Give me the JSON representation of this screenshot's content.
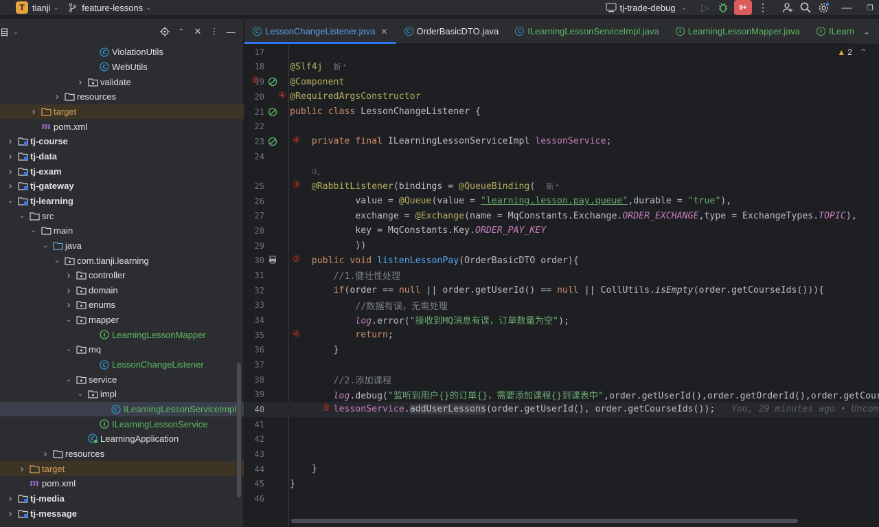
{
  "titlebar": {
    "project_badge": "T",
    "project_name": "tianji",
    "branch": "feature-lessons",
    "run_config": "tj-trade-debug",
    "notifications": "9+"
  },
  "project_panel": {
    "title": "项目",
    "tree": [
      {
        "label": "ViolationUtils",
        "icon": "class",
        "indent": 7,
        "chev": ""
      },
      {
        "label": "WebUtils",
        "icon": "class",
        "indent": 7,
        "chev": ""
      },
      {
        "label": "validate",
        "icon": "package",
        "indent": 6,
        "chev": ">"
      },
      {
        "label": "resources",
        "icon": "folder",
        "indent": 4,
        "chev": ">"
      },
      {
        "label": "target",
        "icon": "folder-orange",
        "indent": 2,
        "chev": ">",
        "style": "target"
      },
      {
        "label": "pom.xml",
        "icon": "maven",
        "indent": 2,
        "chev": ""
      },
      {
        "label": "tj-course",
        "icon": "module",
        "indent": 0,
        "chev": ">",
        "bold": true
      },
      {
        "label": "tj-data",
        "icon": "module",
        "indent": 0,
        "chev": ">",
        "bold": true
      },
      {
        "label": "tj-exam",
        "icon": "module",
        "indent": 0,
        "chev": ">",
        "bold": true
      },
      {
        "label": "tj-gateway",
        "icon": "module",
        "indent": 0,
        "chev": ">",
        "bold": true
      },
      {
        "label": "tj-learning",
        "icon": "module",
        "indent": 0,
        "chev": "v",
        "bold": true
      },
      {
        "label": "src",
        "icon": "folder",
        "indent": 1,
        "chev": "v"
      },
      {
        "label": "main",
        "icon": "folder",
        "indent": 2,
        "chev": "v"
      },
      {
        "label": "java",
        "icon": "folder-blue",
        "indent": 3,
        "chev": "v"
      },
      {
        "label": "com.tianji.learning",
        "icon": "package",
        "indent": 4,
        "chev": "v"
      },
      {
        "label": "controller",
        "icon": "package",
        "indent": 5,
        "chev": ">"
      },
      {
        "label": "domain",
        "icon": "package",
        "indent": 5,
        "chev": ">"
      },
      {
        "label": "enums",
        "icon": "package",
        "indent": 5,
        "chev": ">"
      },
      {
        "label": "mapper",
        "icon": "package",
        "indent": 5,
        "chev": "v"
      },
      {
        "label": "LearningLessonMapper",
        "icon": "interface",
        "indent": 7,
        "chev": "",
        "green": true
      },
      {
        "label": "mq",
        "icon": "package",
        "indent": 5,
        "chev": "v"
      },
      {
        "label": "LessonChangeListener",
        "icon": "class",
        "indent": 7,
        "chev": "",
        "green": true
      },
      {
        "label": "service",
        "icon": "package",
        "indent": 5,
        "chev": "v"
      },
      {
        "label": "impl",
        "icon": "package",
        "indent": 6,
        "chev": "v"
      },
      {
        "label": "ILearningLessonServiceImpl",
        "icon": "class",
        "indent": 8,
        "chev": "",
        "green": true,
        "selected": true
      },
      {
        "label": "ILearningLessonService",
        "icon": "interface",
        "indent": 7,
        "chev": "",
        "green": true
      },
      {
        "label": "LearningApplication",
        "icon": "app",
        "indent": 6,
        "chev": ""
      },
      {
        "label": "resources",
        "icon": "folder",
        "indent": 3,
        "chev": ">"
      },
      {
        "label": "target",
        "icon": "folder-orange",
        "indent": 1,
        "chev": ">",
        "style": "target"
      },
      {
        "label": "pom.xml",
        "icon": "maven",
        "indent": 1,
        "chev": ""
      },
      {
        "label": "tj-media",
        "icon": "module",
        "indent": 0,
        "chev": ">",
        "bold": true
      },
      {
        "label": "tj-message",
        "icon": "module",
        "indent": 0,
        "chev": ">",
        "bold": true
      }
    ]
  },
  "tabs": [
    {
      "label": "LessonChangeListener.java",
      "active": true,
      "closable": true,
      "icon": "class",
      "color": "blue"
    },
    {
      "label": "OrderBasicDTO.java",
      "active": false,
      "icon": "class",
      "color": "plain"
    },
    {
      "label": "ILearningLessonServiceImpl.java",
      "active": false,
      "icon": "class",
      "color": "green"
    },
    {
      "label": "LearningLessonMapper.java",
      "active": false,
      "icon": "interface",
      "color": "green"
    },
    {
      "label": "ILearni",
      "active": false,
      "icon": "interface",
      "color": "green"
    }
  ],
  "editor": {
    "warnings_count": "2",
    "current_line": 40,
    "blame_text": "You, 29 minutes ago • Uncom",
    "new_hint": "新 *",
    "lines": [
      {
        "n": 17,
        "html": ""
      },
      {
        "n": 18,
        "html": "<span class=\"ann\">@Slf4j</span>  <span class=\"hint\">新 *</span>"
      },
      {
        "n": 19,
        "html": "<span class=\"ann\">@Component</span>"
      },
      {
        "n": 20,
        "html": "<span class=\"ann\">@RequiredArgsConstructor</span>"
      },
      {
        "n": 21,
        "html": "<span class=\"kw\">public class </span>LessonChangeListener {"
      },
      {
        "n": 22,
        "html": ""
      },
      {
        "n": 23,
        "html": "    <span class=\"kw\">private final </span>ILearningLessonServiceImpl <span class=\"fld\">lessonService</span>;"
      },
      {
        "n": 24,
        "html": ""
      },
      {
        "n": 0,
        "html": "    <span class=\"hint\">ଓ⌄</span>"
      },
      {
        "n": 25,
        "html": "    <span class=\"ann\">@RabbitListener</span>(bindings = <span class=\"ann\">@QueueBinding</span>(  <span class=\"hint\">新 *</span>"
      },
      {
        "n": 26,
        "html": "            value = <span class=\"ann\">@Queue</span>(value = <span class=\"strul\">\"learning.lesson.pay.queue\"</span>,durable = <span class=\"str\">\"true\"</span>),"
      },
      {
        "n": 27,
        "html": "            exchange = <span class=\"ann\">@Exchange</span>(name = MqConstants.Exchange.<span class=\"cst\">ORDER_EXCHANGE</span>,type = ExchangeTypes.<span class=\"cst\">TOPIC</span>),"
      },
      {
        "n": 28,
        "html": "            key = MqConstants.Key.<span class=\"cst\">ORDER_PAY_KEY</span>"
      },
      {
        "n": 29,
        "html": "            ))"
      },
      {
        "n": 30,
        "html": "    <span class=\"kw\">public void </span><span class=\"fn\">listenLessonPay</span>(OrderBasicDTO order){"
      },
      {
        "n": 31,
        "html": "        <span class=\"cmt\">//1.健壮性处理</span>"
      },
      {
        "n": 32,
        "html": "        <span class=\"kw\">if</span>(order == <span class=\"kw\">null</span> || order.getUserId() == <span class=\"kw\">null</span> || CollUtils.<span class=\"it\">isEmpty</span>(order.getCourseIds())){"
      },
      {
        "n": 33,
        "html": "            <span class=\"cmt\">//数据有误，无需处理</span>"
      },
      {
        "n": 34,
        "html": "            <span class=\"fld it\">log</span>.error(<span class=\"str\">\"接收到MQ消息有误，订单数量为空\"</span>);"
      },
      {
        "n": 35,
        "html": "            <span class=\"kw\">return</span>;"
      },
      {
        "n": 36,
        "html": "        }"
      },
      {
        "n": 37,
        "html": ""
      },
      {
        "n": 38,
        "html": "        <span class=\"cmt\">//2.添加课程</span>"
      },
      {
        "n": 39,
        "html": "        <span class=\"fld it\">log</span>.debug(<span class=\"str\">\"监听到用户{}的订单{}，需要添加课程{}到课表中\"</span>,order.getUserId(),order.getOrderId(),order.getCour"
      },
      {
        "n": 40,
        "html": "        <span class=\"fld\">lessonService</span>.<span class=\"hit\">addUserLessons</span>(order.getUserId(), order.getCourseIds());   <span class=\"blame\">You, 29 minutes ago • Uncom</span>"
      },
      {
        "n": 41,
        "html": ""
      },
      {
        "n": 42,
        "html": ""
      },
      {
        "n": 43,
        "html": ""
      },
      {
        "n": 44,
        "html": "    }"
      },
      {
        "n": 45,
        "html": "}"
      },
      {
        "n": 46,
        "html": ""
      }
    ],
    "markers": [
      {
        "line_index": 2,
        "text": "①",
        "col": "a"
      },
      {
        "line_index": 3,
        "text": "④",
        "col": "b"
      },
      {
        "line_index": 6,
        "text": "④",
        "col": "c"
      },
      {
        "line_index": 9,
        "text": "③",
        "col": "c"
      },
      {
        "line_index": 14,
        "text": "②",
        "col": "c"
      },
      {
        "line_index": 19,
        "text": "④",
        "col": "c"
      },
      {
        "line_index": 24,
        "text": "⑤",
        "col": "d"
      }
    ]
  },
  "colors": {
    "accent": "#3574f0",
    "annotation_red": "#e0302a"
  }
}
